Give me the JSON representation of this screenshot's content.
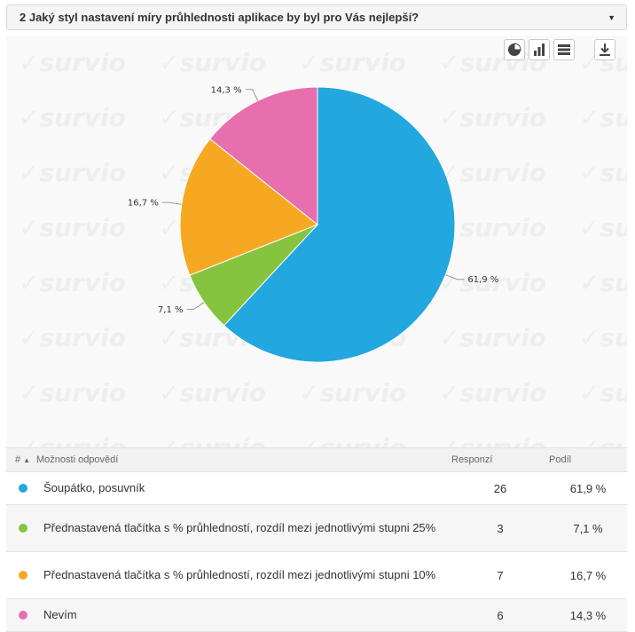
{
  "question": {
    "title": "2 Jaký styl nastavení míry průhlednosti aplikace by byl pro Vás nejlepší?",
    "dropdown_icon": "caret-down-icon"
  },
  "watermark": "survio",
  "toolbar": {
    "icons": [
      "pie-chart-icon",
      "bar-chart-icon",
      "table-icon",
      "download-icon"
    ]
  },
  "table": {
    "headers": {
      "num": "#",
      "sort_icon": "▲",
      "option": "Možnosti odpovědí",
      "responses": "Responzí",
      "share": "Podíl"
    },
    "rows": [
      {
        "color": "#22a7df",
        "label": "Šoupátko, posuvník",
        "responses": "26",
        "share": "61,9 %"
      },
      {
        "color": "#86c440",
        "label": "Přednastavená tlačítka s % průhledností, rozdíl mezi jednotlivými stupni 25%",
        "responses": "3",
        "share": "7,1 %"
      },
      {
        "color": "#f7a823",
        "label": "Přednastavená tlačítka s % průhledností, rozdíl mezi jednotlivými stupni 10%",
        "responses": "7",
        "share": "16,7 %"
      },
      {
        "color": "#e86fae",
        "label": "Nevím",
        "responses": "6",
        "share": "14,3 %"
      }
    ]
  },
  "chart_data": {
    "type": "pie",
    "categories": [
      "Šoupátko, posuvník",
      "Přednastavená tlačítka s % průhledností, rozdíl mezi jednotlivými stupni 25%",
      "Přednastavená tlačítka s % průhledností, rozdíl mezi jednotlivými stupni 10%",
      "Nevím"
    ],
    "values": [
      61.9,
      7.1,
      16.7,
      14.3
    ],
    "labels": [
      "61,9 %",
      "7,1 %",
      "16,7 %",
      "14,3 %"
    ],
    "colors": [
      "#22a7df",
      "#86c440",
      "#f7a823",
      "#e86fae"
    ],
    "start": "12 o'clock",
    "direction": "clockwise"
  }
}
